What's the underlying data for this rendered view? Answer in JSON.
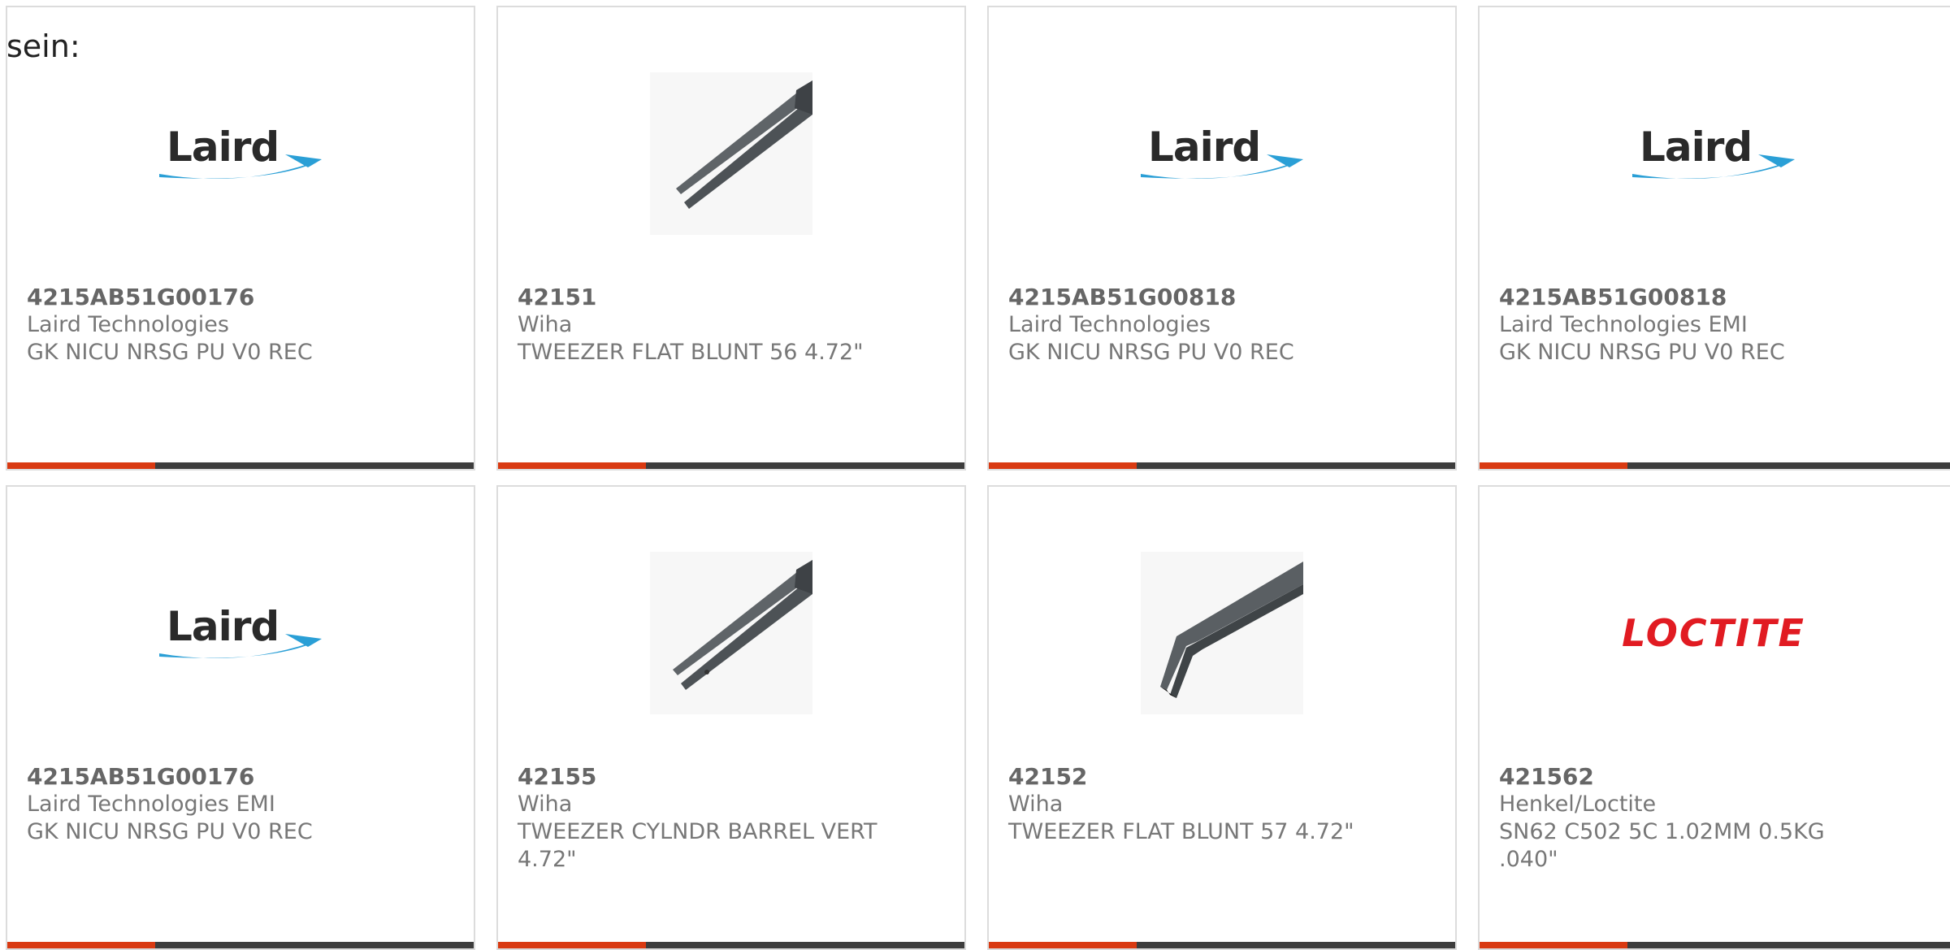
{
  "top_text": "sein:",
  "colors": {
    "accent": "#d93a12",
    "bar": "#3d3d3d",
    "laird_swoosh": "#2a9fd6",
    "loctite_red": "#e11b22"
  },
  "cards": [
    {
      "part_number": "4215AB51G00176",
      "manufacturer": "Laird Technologies",
      "description": "GK NICU NRSG PU V0 REC",
      "image": "laird-logo",
      "logo_text": "Laird"
    },
    {
      "part_number": "42151",
      "manufacturer": "Wiha",
      "description": "TWEEZER FLAT BLUNT 56 4.72\"",
      "image": "tweezer-straight"
    },
    {
      "part_number": "4215AB51G00818",
      "manufacturer": "Laird Technologies",
      "description": "GK NICU NRSG PU V0 REC",
      "image": "laird-logo",
      "logo_text": "Laird"
    },
    {
      "part_number": "4215AB51G00818",
      "manufacturer": "Laird Technologies EMI",
      "description": "GK NICU NRSG PU V0 REC",
      "image": "laird-logo",
      "logo_text": "Laird"
    },
    {
      "part_number": "4215AB51G00176",
      "manufacturer": "Laird Technologies EMI",
      "description": "GK NICU NRSG PU V0 REC",
      "image": "laird-logo",
      "logo_text": "Laird"
    },
    {
      "part_number": "42155",
      "manufacturer": "Wiha",
      "description": "TWEEZER CYLNDR BARREL VERT\n4.72\"",
      "image": "tweezer-straight"
    },
    {
      "part_number": "42152",
      "manufacturer": "Wiha",
      "description": "TWEEZER FLAT BLUNT 57 4.72\"",
      "image": "tweezer-bent"
    },
    {
      "part_number": "421562",
      "manufacturer": "Henkel/Loctite",
      "description": "SN62 C502 5C 1.02MM 0.5KG\n.040\"",
      "image": "loctite-logo",
      "logo_text": "LOCTITE"
    }
  ]
}
